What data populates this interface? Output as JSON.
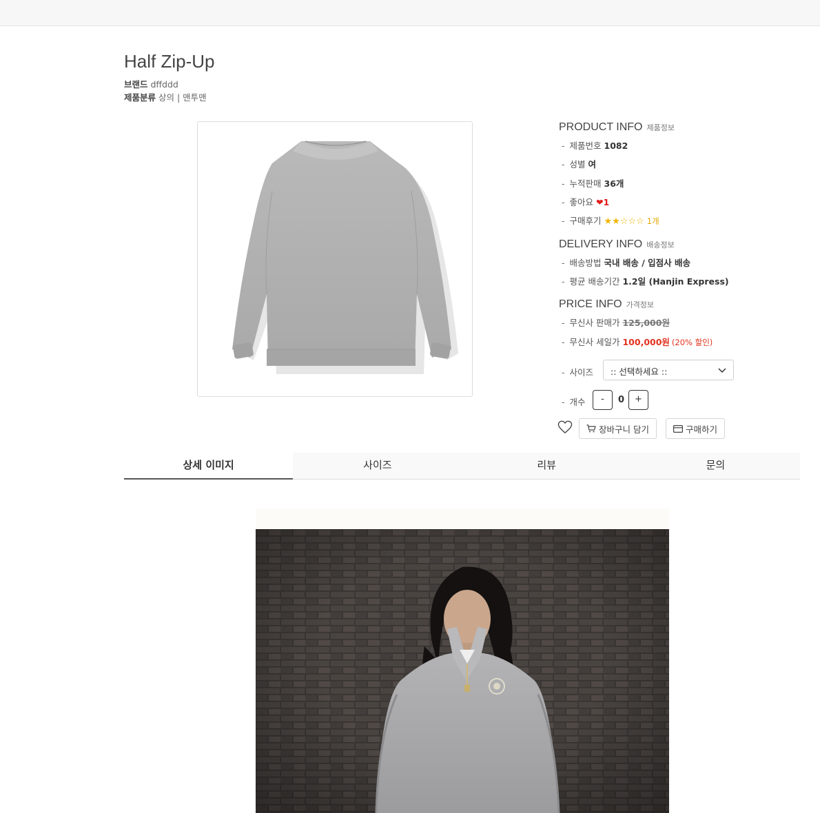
{
  "product": {
    "title": "Half Zip-Up",
    "brand_label": "브랜드",
    "brand_value": "dffddd",
    "category_label": "제품분류",
    "category_value": "상의 | 맨투맨"
  },
  "product_info": {
    "title": "PRODUCT INFO",
    "subtitle": "제품정보",
    "rows": [
      {
        "label": "제품번호",
        "value": "1082"
      },
      {
        "label": "성별",
        "value": "여"
      },
      {
        "label": "누적판매",
        "value": "36개"
      },
      {
        "label": "좋아요",
        "value": "1"
      },
      {
        "label": "구매후기",
        "value": "1개"
      }
    ],
    "rating": 2,
    "rating_max": 5
  },
  "delivery_info": {
    "title": "DELIVERY INFO",
    "subtitle": "배송정보",
    "rows": [
      {
        "label": "배송방법",
        "value": "국내 배송 / 입점사 배송"
      },
      {
        "label": "평균 배송기간",
        "value": "1.2일 (Hanjin Express)"
      }
    ]
  },
  "price_info": {
    "title": "PRICE INFO",
    "subtitle": "가격정보",
    "original_label": "무신사 판매가",
    "original_price": "125,000원",
    "sale_label": "무신사 세일가",
    "sale_price": "100,000원",
    "discount": "(20% 할인)"
  },
  "options": {
    "size_label": "사이즈",
    "size_selected": ":: 선택하세요 ::",
    "qty_label": "개수",
    "qty_minus": "-",
    "qty_value": "0",
    "qty_plus": "+"
  },
  "actions": {
    "cart_label": "장바구니 담기",
    "buy_label": "구매하기"
  },
  "tabs": [
    {
      "label": "상세 이미지",
      "active": true
    },
    {
      "label": "사이즈",
      "active": false
    },
    {
      "label": "리뷰",
      "active": false
    },
    {
      "label": "문의",
      "active": false
    }
  ],
  "colors": {
    "sale": "#e2321f",
    "star": "#f0b400",
    "heart": "#e21b1b"
  }
}
